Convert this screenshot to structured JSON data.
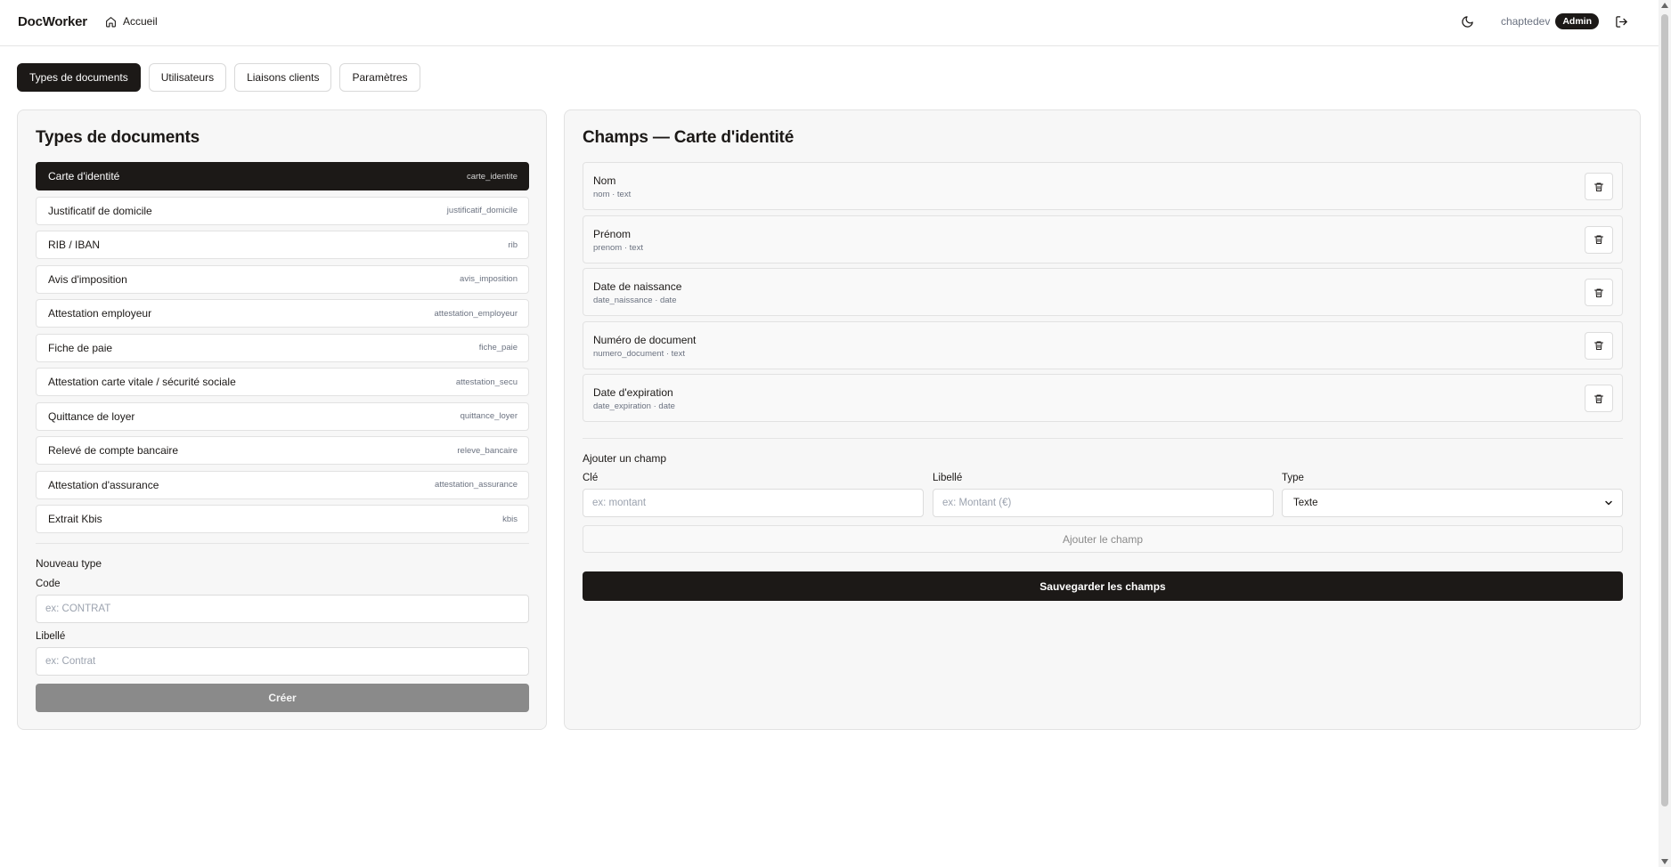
{
  "header": {
    "brand": "DocWorker",
    "home_label": "Accueil",
    "username": "chaptedev",
    "role_badge": "Admin",
    "icons": {
      "home": "home-icon",
      "theme": "moon-icon",
      "logout": "logout-icon"
    }
  },
  "tabs": [
    {
      "label": "Types de documents",
      "active": true
    },
    {
      "label": "Utilisateurs",
      "active": false
    },
    {
      "label": "Liaisons clients",
      "active": false
    },
    {
      "label": "Paramètres",
      "active": false
    }
  ],
  "left_panel": {
    "title": "Types de documents",
    "types": [
      {
        "label": "Carte d'identité",
        "code": "carte_identite",
        "active": true
      },
      {
        "label": "Justificatif de domicile",
        "code": "justificatif_domicile",
        "active": false
      },
      {
        "label": "RIB / IBAN",
        "code": "rib",
        "active": false
      },
      {
        "label": "Avis d'imposition",
        "code": "avis_imposition",
        "active": false
      },
      {
        "label": "Attestation employeur",
        "code": "attestation_employeur",
        "active": false
      },
      {
        "label": "Fiche de paie",
        "code": "fiche_paie",
        "active": false
      },
      {
        "label": "Attestation carte vitale / sécurité sociale",
        "code": "attestation_secu",
        "active": false
      },
      {
        "label": "Quittance de loyer",
        "code": "quittance_loyer",
        "active": false
      },
      {
        "label": "Relevé de compte bancaire",
        "code": "releve_bancaire",
        "active": false
      },
      {
        "label": "Attestation d'assurance",
        "code": "attestation_assurance",
        "active": false
      },
      {
        "label": "Extrait Kbis",
        "code": "kbis",
        "active": false
      }
    ],
    "new_type": {
      "section_title": "Nouveau type",
      "code_label": "Code",
      "code_placeholder": "ex: CONTRAT",
      "label_label": "Libellé",
      "label_placeholder": "ex: Contrat",
      "create_button": "Créer"
    }
  },
  "right_panel": {
    "title": "Champs — Carte d'identité",
    "fields": [
      {
        "name": "Nom",
        "meta": "nom · text"
      },
      {
        "name": "Prénom",
        "meta": "prenom · text"
      },
      {
        "name": "Date de naissance",
        "meta": "date_naissance · date"
      },
      {
        "name": "Numéro de document",
        "meta": "numero_document · text"
      },
      {
        "name": "Date d'expiration",
        "meta": "date_expiration · date"
      }
    ],
    "add_field": {
      "section_title": "Ajouter un champ",
      "key_label": "Clé",
      "key_placeholder": "ex: montant",
      "label_label": "Libellé",
      "label_placeholder": "ex: Montant (€)",
      "type_label": "Type",
      "type_value": "Texte",
      "add_button": "Ajouter le champ"
    },
    "save_button": "Sauvegarder les champs"
  },
  "colors": {
    "primary": "#1c1917",
    "muted_button": "#8a8a8a",
    "panel_bg": "#f7f7f7",
    "border": "#e2e2e2"
  }
}
